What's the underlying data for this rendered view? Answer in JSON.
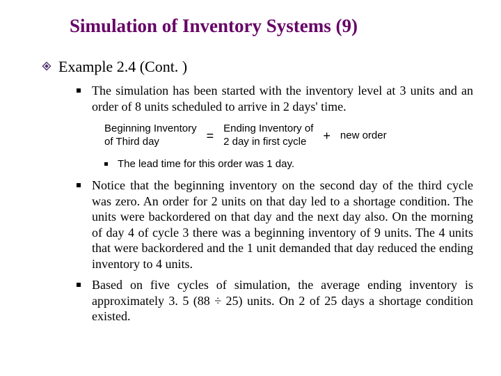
{
  "title": "Simulation of Inventory Systems (9)",
  "level1": {
    "heading": "Example 2.4 (Cont. )"
  },
  "bullets": {
    "b1": "The simulation has been started with the inventory level at 3 units and an order of 8 units scheduled to arrive in 2 days' time.",
    "equation": {
      "left_line1": "Beginning Inventory",
      "left_line2": "of Third day",
      "eq_sign": "=",
      "mid_line1": "Ending Inventory of",
      "mid_line2": "2 day in first cycle",
      "plus_sign": "+",
      "right": "new order"
    },
    "b1a": "The lead time for this order was 1 day.",
    "b2": "Notice that the beginning inventory on the second day of the third cycle was zero. An order for 2 units on that day led to a shortage condition. The units were backordered on that day and the next day also. On the morning of day 4 of cycle 3 there was a beginning inventory of 9 units. The 4 units that were backordered and the 1 unit demanded that day reduced the ending inventory to 4 units.",
    "b3": "Based on five cycles of simulation, the average ending inventory is approximately 3. 5 (88 ÷ 25) units. On 2 of 25 days a shortage condition existed."
  }
}
